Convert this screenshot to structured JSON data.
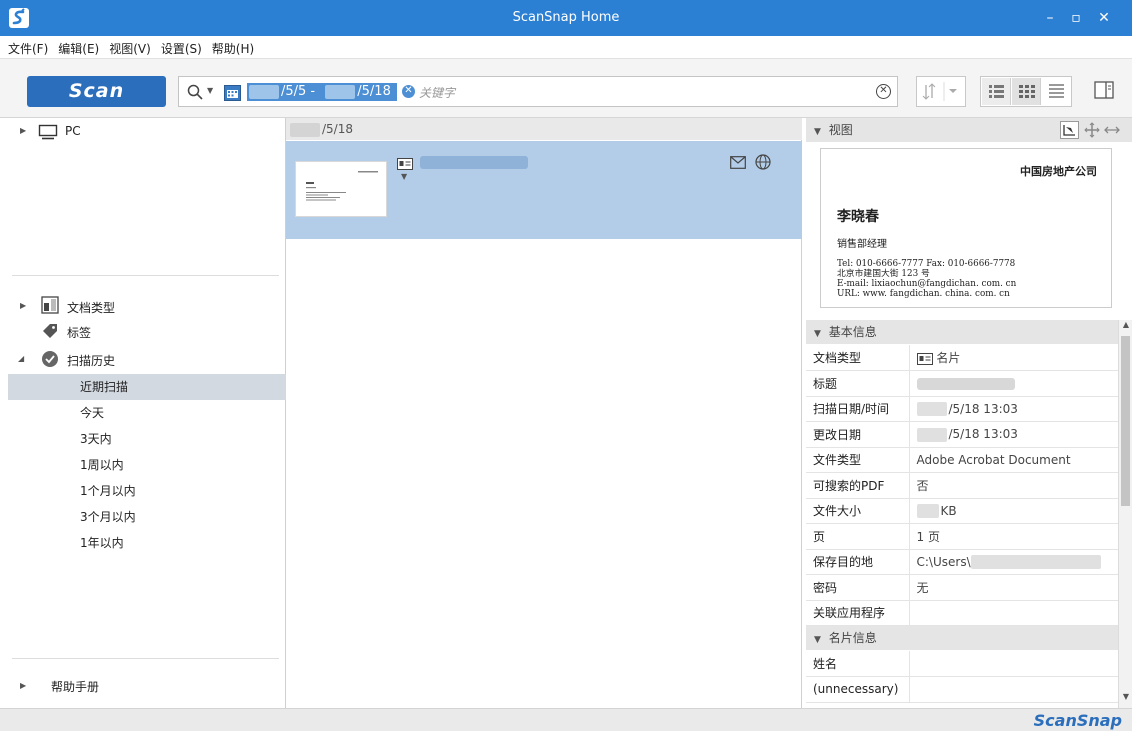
{
  "window": {
    "title": "ScanSnap Home"
  },
  "menu": {
    "items": [
      "文件(F)",
      "编辑(E)",
      "视图(V)",
      "设置(S)",
      "帮助(H)"
    ]
  },
  "toolbar": {
    "scan_label": "Scan",
    "date_from": "/5/5 -",
    "date_to": "/5/18",
    "keyword_placeholder": "关键字"
  },
  "left": {
    "pc_label": "PC",
    "doc_type_label": "文档类型",
    "tags_label": "标签",
    "history_label": "扫描历史",
    "history_items": [
      "近期扫描",
      "今天",
      "3天内",
      "1周以内",
      "1个月以内",
      "3个月以内",
      "1年以内"
    ],
    "help_label": "帮助手册"
  },
  "list": {
    "group_date": "/5/18",
    "item_title": ""
  },
  "preview": {
    "section_label": "视图",
    "card": {
      "company": "中国房地产公司",
      "name": "李晓春",
      "position": "销售部经理",
      "line1": "Tel: 010-6666-7777   Fax: 010-6666-7778",
      "line2": "北京市建国大街 123 号",
      "line3": "E-mail: lixiaochun@fangdichan. com. cn",
      "line4": "URL: www. fangdichan. china. com. cn"
    }
  },
  "basic_info": {
    "section_label": "基本信息",
    "rows": [
      {
        "key": "文档类型",
        "value": "名片"
      },
      {
        "key": "标题",
        "value": ""
      },
      {
        "key": "扫描日期/时间",
        "value": "/5/18 13:03"
      },
      {
        "key": "更改日期",
        "value": "/5/18 13:03"
      },
      {
        "key": "文件类型",
        "value": "Adobe Acrobat Document"
      },
      {
        "key": "可搜索的PDF",
        "value": "否"
      },
      {
        "key": "文件大小",
        "value": "KB"
      },
      {
        "key": "页",
        "value": "1 页"
      },
      {
        "key": "保存目的地",
        "value": "C:\\Users\\"
      },
      {
        "key": "密码",
        "value": "无"
      },
      {
        "key": "关联应用程序",
        "value": ""
      }
    ]
  },
  "card_info": {
    "section_label": "名片信息",
    "rows": [
      {
        "key": "姓名",
        "value": ""
      },
      {
        "key": "(unnecessary)",
        "value": ""
      }
    ]
  },
  "status": {
    "brand": "ScanSnap"
  },
  "colors": {
    "titlebar": "#2c80d3",
    "accent": "#2a6ebc",
    "selection": "#b3cde9"
  }
}
